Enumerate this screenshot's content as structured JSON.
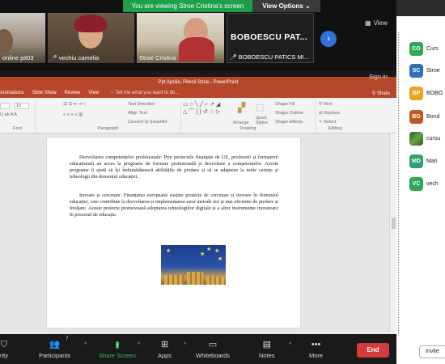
{
  "share_banner": {
    "message": "You are viewing Stroe Cristina's screen",
    "view_options": "View Options"
  },
  "gallery": {
    "tiles": [
      {
        "name": "online pit03"
      },
      {
        "name": "vechiu camelia"
      },
      {
        "name": "Stroe Cristina"
      },
      {
        "name": "BOBOESCU PATICS MI..."
      }
    ],
    "large_name": "BOBOESCU  PAT...",
    "view_label": "View",
    "sign_in": "Sign in"
  },
  "ppt": {
    "title": "Ppt Aprilie, Pitesti Stroe - PowerPoint",
    "tabs": [
      "Animations",
      "Slide Show",
      "Review",
      "View"
    ],
    "tell_me": "Tell me what you want to do...",
    "share": "Share",
    "ribbon": {
      "font_label": "Font",
      "paragraph_label": "Paragraph",
      "drawing_label": "Drawing",
      "editing_label": "Editing",
      "text_direction": "Text Direction",
      "align_text": "Align Text",
      "convert_smartart": "Convert to SmartArt",
      "arrange": "Arrange",
      "quick_styles": "Quick Styles",
      "shape_fill": "Shape Fill",
      "shape_outline": "Shape Outline",
      "shape_effects": "Shape Effects",
      "find": "Find",
      "replace": "Replace",
      "select": "Select",
      "font_size": "10"
    },
    "slide": {
      "paragraph_1": "Dezvoltarea competențelor profesionale: Prin proiectele finanțate de UE, profesorii și formatorii educaționali au acces la programe de formare profesională și dezvoltare a competențelor. Aceste programe îi ajută să își îmbunătățească abilitățile de predare și să se adapteze la noile cerințe și tehnologii din domeniul educației.",
      "paragraph_2": "Inovare și cercetare: Finanțarea europeană susține proiecte de cercetare și inovare în domeniul educației, care contribuie la dezvoltarea și implementarea unor metode noi și mai eficiente de predare și învățare. Aceste proiecte promovează adoptarea tehnologiilor digitale și a altor instrumente inovatoare în procesul de educație."
    }
  },
  "participants": [
    {
      "initials": "CO",
      "name": "Curs",
      "color": "#2fa84f"
    },
    {
      "initials": "SC",
      "name": "Stroe",
      "color": "#2f6fb7"
    },
    {
      "initials": "BP",
      "name": "BOBO",
      "color": "#f0a020"
    },
    {
      "initials": "BG",
      "name": "Bond",
      "color": "#c05a1c"
    },
    {
      "initials": "",
      "name": "cursu",
      "color": "#4c7a30"
    },
    {
      "initials": "MD",
      "name": "Mari",
      "color": "#2fa070"
    },
    {
      "initials": "VC",
      "name": "vech",
      "color": "#2fa84f"
    }
  ],
  "invite_label": "Invite",
  "toolbar": {
    "security": "rity",
    "participants": "Participants",
    "participants_count": "7",
    "share_screen": "Share Screen",
    "apps": "Apps",
    "whiteboards": "Whiteboards",
    "notes": "Notes",
    "more": "More",
    "end": "End"
  }
}
